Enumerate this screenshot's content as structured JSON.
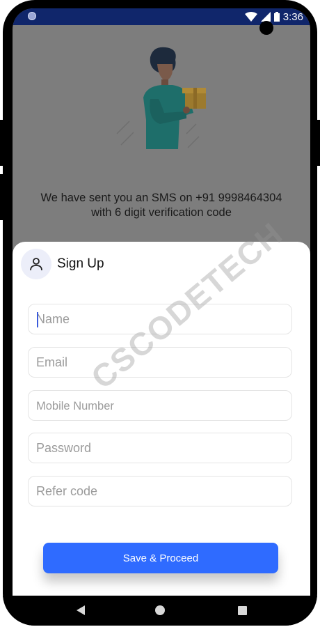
{
  "status_bar": {
    "time": "3:36"
  },
  "background": {
    "sms_line1": "We have sent you an SMS on +91 9998464304",
    "sms_line2": "with 6 digit verification code"
  },
  "sheet": {
    "title": "Sign Up",
    "fields": [
      {
        "placeholder": "Name"
      },
      {
        "placeholder": "Email"
      },
      {
        "placeholder": "Mobile Number"
      },
      {
        "placeholder": "Password"
      },
      {
        "placeholder": "Refer code"
      }
    ],
    "proceed_label": "Save & Proceed"
  },
  "watermark": "CSCODETECH",
  "colors": {
    "status_bar": "#10266b",
    "accent": "#2f6bff",
    "overlay": "#7d7d7d"
  }
}
